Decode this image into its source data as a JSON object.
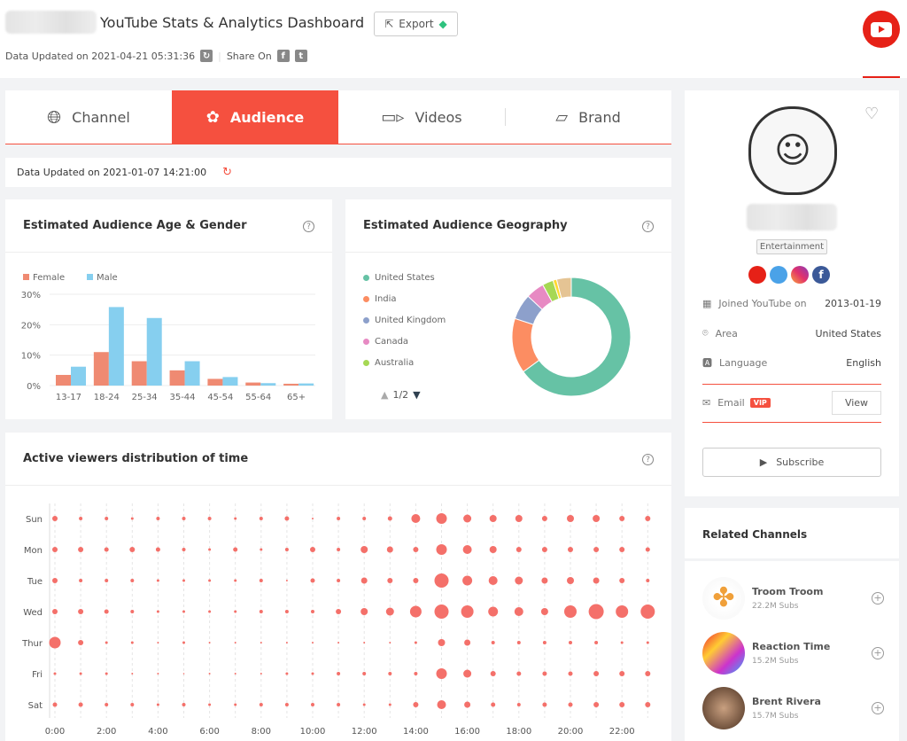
{
  "header": {
    "title": "YouTube Stats & Analytics Dashboard",
    "export_label": "Export",
    "updated": "Data Updated on 2021-04-21 05:31:36",
    "share_label": "Share On"
  },
  "tabs": [
    {
      "label": "Channel",
      "icon": "globe-icon"
    },
    {
      "label": "Audience",
      "icon": "audience-icon",
      "active": true
    },
    {
      "label": "Videos",
      "icon": "video-camera-icon"
    },
    {
      "label": "Brand",
      "icon": "brand-icon"
    }
  ],
  "audience_updated": "Data Updated on 2021-01-07 14:21:00",
  "accent": "#f5503f",
  "age_gender": {
    "title": "Estimated Audience Age & Gender"
  },
  "geography": {
    "title": "Estimated Audience Geography",
    "pager": "1/2"
  },
  "active_viewers": {
    "title": "Active viewers distribution of time"
  },
  "chart_data": [
    {
      "type": "bar",
      "categories": [
        "13-17",
        "18-24",
        "25-34",
        "35-44",
        "45-54",
        "55-64",
        "65+"
      ],
      "series": [
        {
          "name": "Female",
          "color": "#ef8a72",
          "values": [
            3.5,
            11,
            8,
            5,
            2.2,
            1,
            0.6
          ]
        },
        {
          "name": "Male",
          "color": "#86cfef",
          "values": [
            6.2,
            25.8,
            22.2,
            8,
            2.8,
            0.8,
            0.7
          ]
        }
      ],
      "yticks": [
        "0%",
        "10%",
        "20%",
        "30%"
      ],
      "ylim": [
        0,
        30
      ],
      "grid": true,
      "legend": "top-left"
    },
    {
      "type": "pie",
      "donut": true,
      "labels": [
        "United States",
        "India",
        "United Kingdom",
        "Canada",
        "Australia",
        "",
        ""
      ],
      "values": [
        65,
        15,
        7,
        5,
        3,
        1,
        4
      ],
      "colors": [
        "#66c2a5",
        "#fc8d62",
        "#8da0cb",
        "#e78ac3",
        "#a6d854",
        "#ffd92f",
        "#e5c494"
      ],
      "legend": "left"
    },
    {
      "type": "scatter",
      "xticks": [
        "0:00",
        "2:00",
        "4:00",
        "6:00",
        "8:00",
        "10:00",
        "12:00",
        "14:00",
        "16:00",
        "18:00",
        "20:00",
        "22:00"
      ],
      "days": [
        "Sun",
        "Mon",
        "Tue",
        "Wed",
        "Thur",
        "Fri",
        "Sat"
      ],
      "color": "#f4706a",
      "values": [
        [
          3,
          2,
          2,
          1.5,
          2,
          2,
          2,
          1.5,
          2,
          2.5,
          1,
          2,
          2,
          2.5,
          5,
          6,
          4.5,
          4,
          4,
          3,
          4,
          4,
          3,
          3
        ],
        [
          3,
          3,
          2.5,
          3,
          2.5,
          2,
          1.5,
          2.5,
          1.5,
          2,
          3,
          2,
          4,
          3.5,
          3,
          6,
          5,
          4,
          3,
          3,
          3,
          3,
          3,
          2.5
        ],
        [
          3,
          2,
          2,
          2,
          1.5,
          1.5,
          1.5,
          1.5,
          2,
          1,
          2.5,
          2,
          3.5,
          3,
          3,
          8,
          5.5,
          5,
          4.5,
          3.5,
          4,
          3.5,
          3,
          2
        ],
        [
          3,
          3,
          2.5,
          2,
          1.5,
          1.5,
          1.5,
          1.5,
          2,
          2,
          2,
          3,
          4,
          4.5,
          6.5,
          8,
          7,
          5.5,
          5,
          4,
          7,
          8.5,
          7,
          8
        ],
        [
          6.5,
          3,
          1.5,
          1.5,
          1,
          1.5,
          1,
          1,
          1,
          1,
          1,
          1,
          1,
          1,
          1.5,
          4,
          3.5,
          2,
          2,
          2,
          2,
          2,
          1.5,
          1.5
        ],
        [
          1.5,
          1.5,
          1.5,
          1,
          1,
          0.8,
          1,
          1,
          1,
          1.5,
          1.5,
          2,
          2,
          2,
          2,
          6,
          4.5,
          3,
          2.5,
          2.5,
          2.5,
          3,
          3,
          3
        ],
        [
          2.5,
          2.5,
          2,
          2,
          1.5,
          2,
          1.5,
          1.5,
          2,
          2,
          2,
          2,
          1.5,
          1.5,
          3,
          5,
          3.5,
          2.5,
          2,
          2.5,
          2.5,
          3,
          3,
          3
        ]
      ]
    }
  ],
  "profile": {
    "category": "Entertainment",
    "joined_label": "Joined YouTube on",
    "joined": "2013-01-19",
    "area_label": "Area",
    "area": "United States",
    "language_label": "Language",
    "language": "English",
    "email_label": "Email",
    "vip": "VIP",
    "view_label": "View",
    "subscribe_label": "Subscribe"
  },
  "related": {
    "title": "Related Channels",
    "items": [
      {
        "name": "Troom Troom",
        "subs": "22.2M Subs"
      },
      {
        "name": "Reaction Time",
        "subs": "15.2M Subs"
      },
      {
        "name": "Brent Rivera",
        "subs": "15.7M Subs"
      }
    ]
  }
}
